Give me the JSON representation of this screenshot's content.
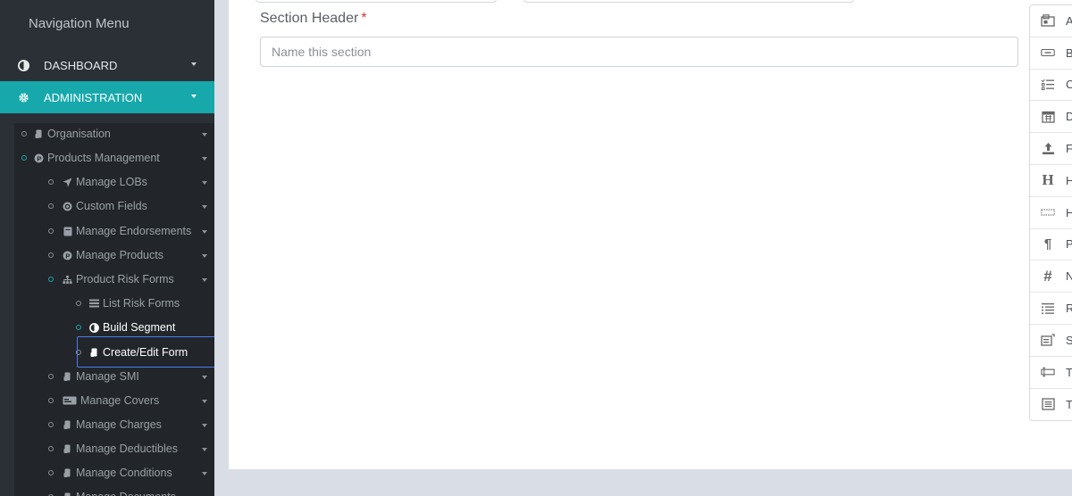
{
  "sidebar": {
    "title": "Navigation Menu",
    "top_items": [
      {
        "label": "DASHBOARD",
        "icon": "half-circle-icon",
        "active": false
      },
      {
        "label": "ADMINISTRATION",
        "icon": "gear-icon",
        "active": true
      }
    ],
    "sub_items": [
      {
        "label": "Organisation",
        "icon": "doc-hand-icon",
        "level": 1,
        "caret": true
      },
      {
        "label": "Products Management",
        "icon": "p-circle-icon",
        "level": 1,
        "caret": true,
        "teal": true
      },
      {
        "label": "Manage LOBs",
        "icon": "send-icon",
        "level": 2,
        "caret": true
      },
      {
        "label": "Custom Fields",
        "icon": "copyright-icon",
        "level": 2,
        "caret": true
      },
      {
        "label": "Manage Endorsements",
        "icon": "book-icon",
        "level": 2,
        "caret": true
      },
      {
        "label": "Manage Products",
        "icon": "p-circle-icon",
        "level": 2,
        "caret": true
      },
      {
        "label": "Product Risk Forms",
        "icon": "sitemap-icon",
        "level": 2,
        "caret": true,
        "teal": true
      },
      {
        "label": "List Risk Forms",
        "icon": "list-icon",
        "level": 3,
        "caret": false
      },
      {
        "label": "Build Segment",
        "icon": "half-circle-icon",
        "level": 3,
        "caret": false,
        "bright": true,
        "teal": true
      },
      {
        "label": "Create/Edit Form",
        "icon": "doc-hand-icon",
        "level": 3,
        "caret": false,
        "bright": true,
        "selected": true
      },
      {
        "label": "Manage SMI",
        "icon": "doc-hand-icon",
        "level": 2,
        "caret": true
      },
      {
        "label": "Manage Covers",
        "icon": "card-icon",
        "level": 2,
        "caret": true
      },
      {
        "label": "Manage Charges",
        "icon": "doc-hand-icon",
        "level": 2,
        "caret": true
      },
      {
        "label": "Manage Deductibles",
        "icon": "doc-hand-icon",
        "level": 2,
        "caret": true
      },
      {
        "label": "Manage Conditions",
        "icon": "doc-hand-icon",
        "level": 2,
        "caret": true
      },
      {
        "label": "Manage Documents",
        "icon": "doc-hand-icon",
        "level": 2,
        "caret": true
      }
    ]
  },
  "form": {
    "section_label": "Section Header",
    "required_mark": "*",
    "section_placeholder": "Name this section"
  },
  "palette": {
    "items": [
      {
        "label": "A",
        "icon": "address-icon"
      },
      {
        "label": "B",
        "icon": "button-icon"
      },
      {
        "label": "C",
        "icon": "checklist-icon"
      },
      {
        "label": "D",
        "icon": "calendar-icon"
      },
      {
        "label": "Fi",
        "icon": "upload-icon"
      },
      {
        "label": "H",
        "icon": "heading-icon"
      },
      {
        "label": "H",
        "icon": "hidden-field-icon"
      },
      {
        "label": "Pa",
        "icon": "paragraph-icon"
      },
      {
        "label": "N",
        "icon": "hash-icon"
      },
      {
        "label": "R",
        "icon": "radio-list-icon"
      },
      {
        "label": "Se",
        "icon": "select-icon"
      },
      {
        "label": "Te",
        "icon": "text-field-icon"
      },
      {
        "label": "Te",
        "icon": "textarea-icon"
      }
    ]
  },
  "colors": {
    "accent": "#17a8ab",
    "sidebar_bg": "#2b3036",
    "selection_border": "#4a7cf0",
    "required": "#d9343b"
  }
}
